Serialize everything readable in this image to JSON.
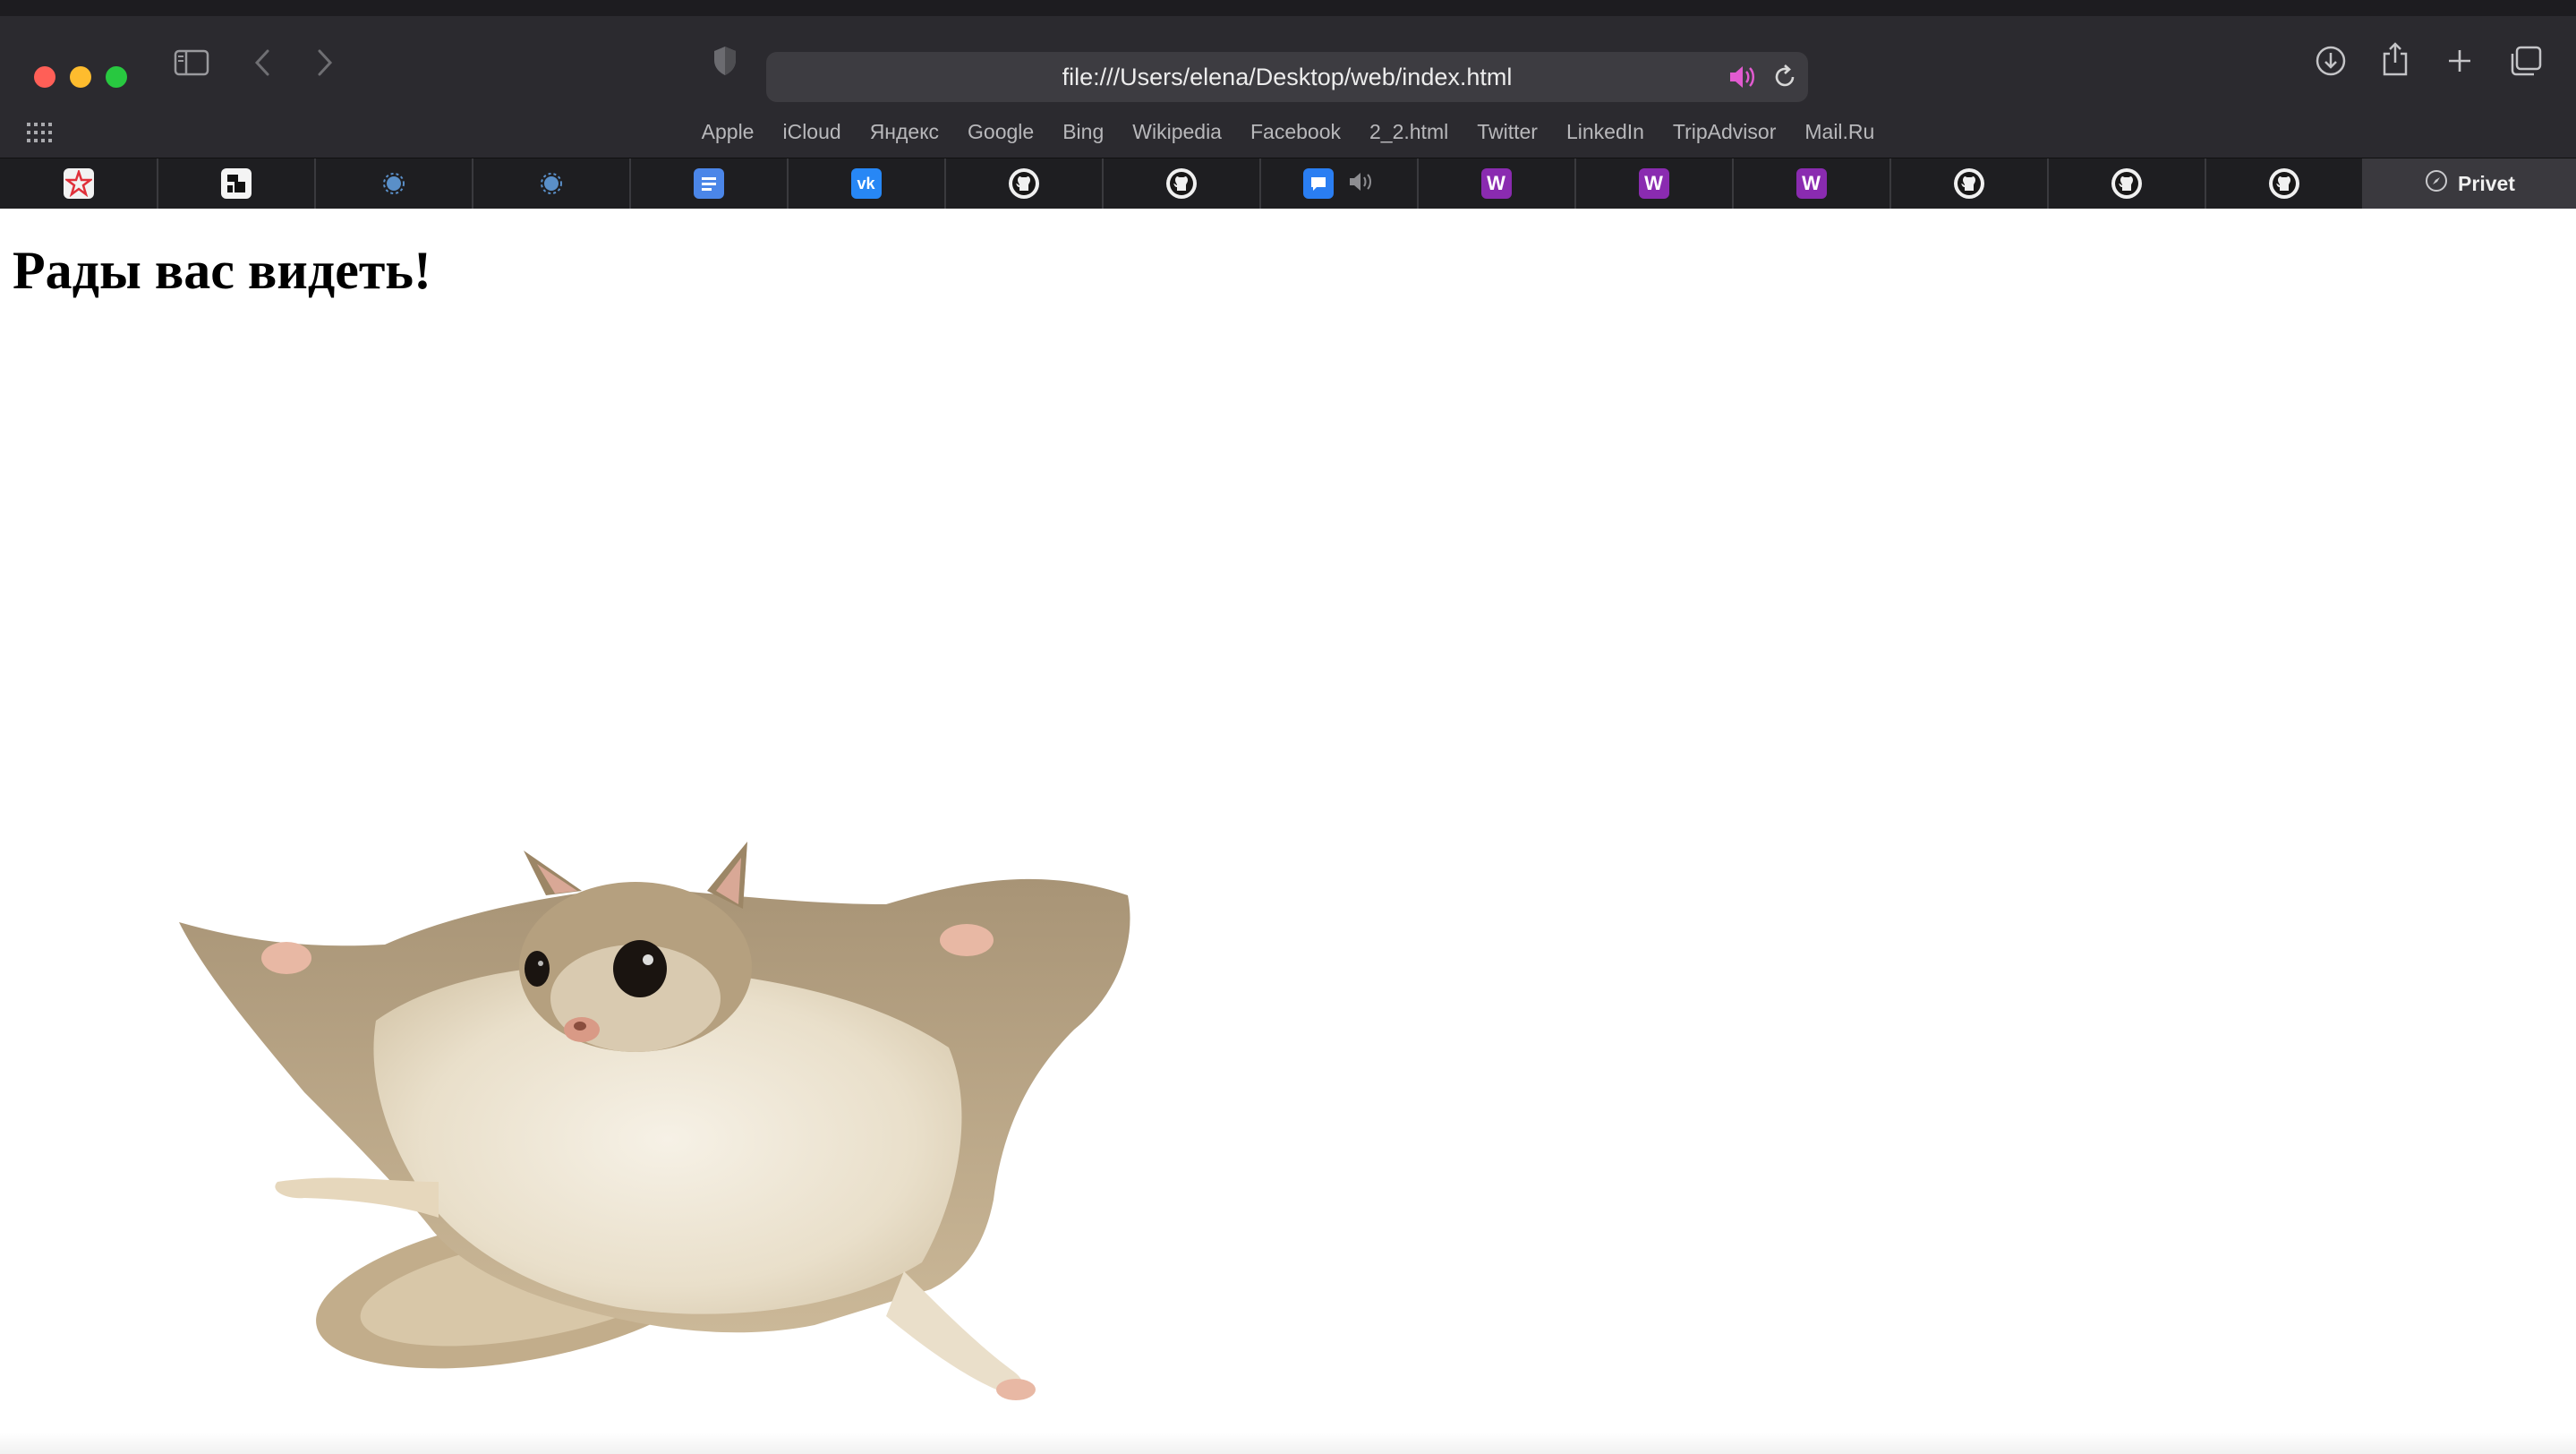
{
  "browser": {
    "address": "file:///Users/elena/Desktop/web/index.html",
    "favorites": [
      "Apple",
      "iCloud",
      "Яндекс",
      "Google",
      "Bing",
      "Wikipedia",
      "Facebook",
      "2_2.html",
      "Twitter",
      "LinkedIn",
      "TripAdvisor",
      "Mail.Ru"
    ],
    "tabs": [
      {
        "icon": "red-star-favicon"
      },
      {
        "icon": "black-square-favicon"
      },
      {
        "icon": "blue-blob-favicon"
      },
      {
        "icon": "blue-blob-favicon"
      },
      {
        "icon": "docs-favicon"
      },
      {
        "icon": "vk-favicon",
        "glyph": "vk"
      },
      {
        "icon": "github-favicon"
      },
      {
        "icon": "github-favicon"
      },
      {
        "icon": "chat-favicon",
        "playing": true
      },
      {
        "icon": "w-favicon",
        "glyph": "W"
      },
      {
        "icon": "w-favicon",
        "glyph": "W"
      },
      {
        "icon": "w-favicon",
        "glyph": "W"
      },
      {
        "icon": "github-favicon"
      },
      {
        "icon": "github-favicon"
      },
      {
        "icon": "github-favicon"
      }
    ],
    "active_tab": "Privet"
  },
  "page": {
    "heading": "Рады вас видеть!",
    "image": "flying-squirrel-photo"
  },
  "colors": {
    "chrome": "#2b2a2f",
    "tabbar": "#1e1e21",
    "accent_pink": "#e25bd0",
    "w_purple": "#8a2bb0",
    "vk_blue": "#2787f5"
  }
}
